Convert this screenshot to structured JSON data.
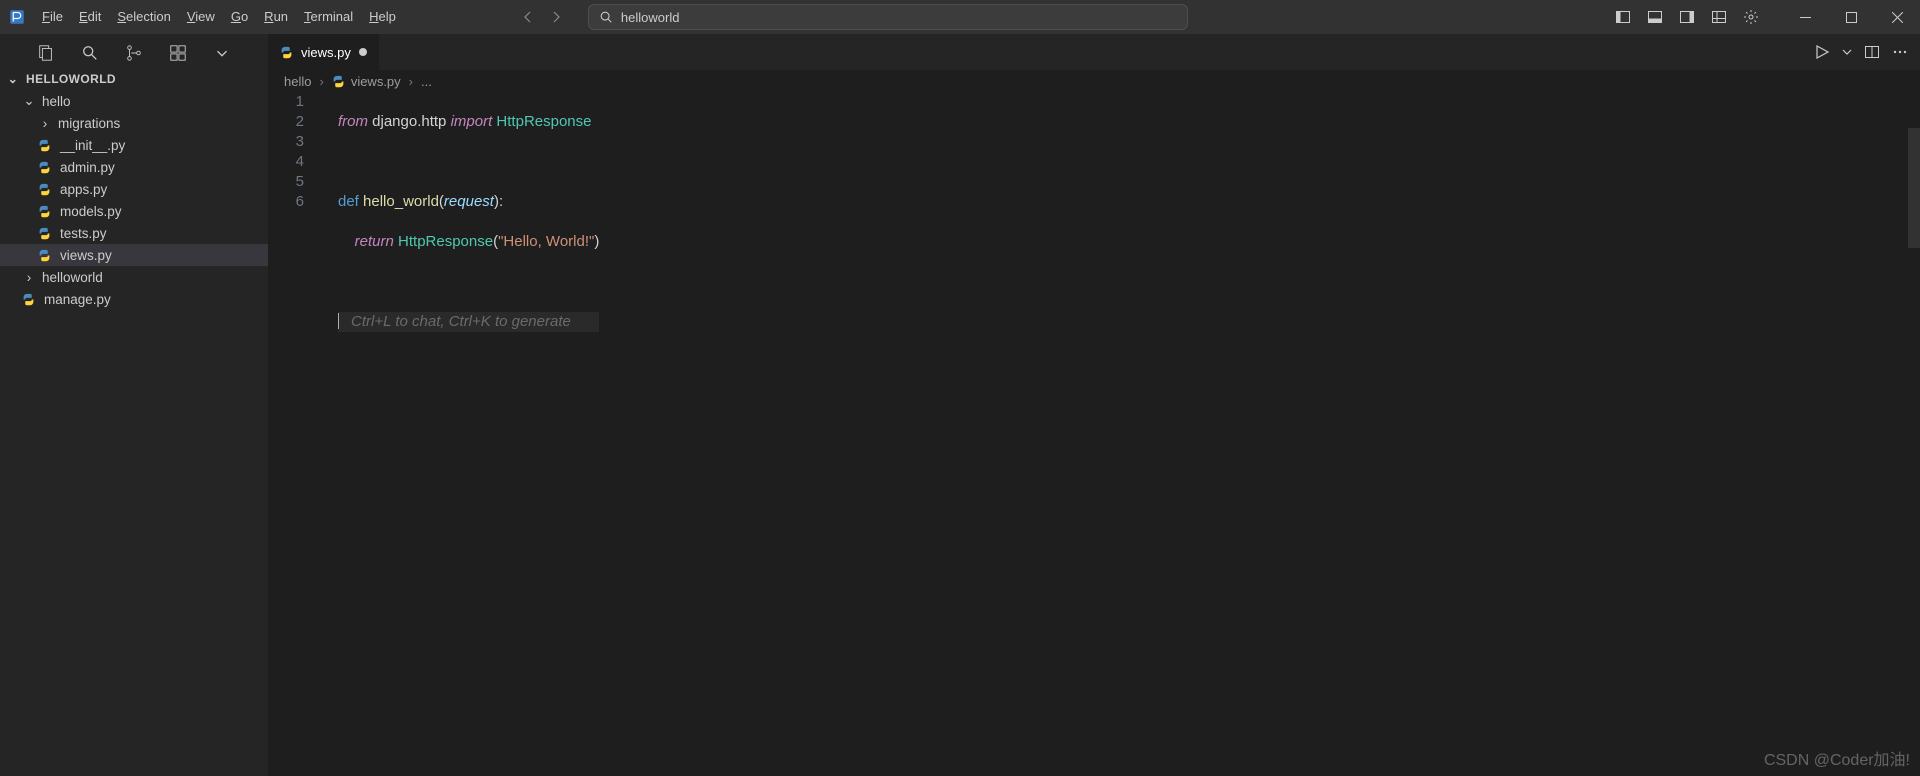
{
  "app": {
    "search_text": "helloworld",
    "project": "HELLOWORLD"
  },
  "menu": {
    "file": "File",
    "edit": "Edit",
    "selection": "Selection",
    "view": "View",
    "go": "Go",
    "run": "Run",
    "terminal": "Terminal",
    "help": "Help"
  },
  "tree": {
    "root_expanded": true,
    "items": [
      {
        "type": "folder",
        "name": "hello",
        "expanded": true,
        "depth": 1
      },
      {
        "type": "folder",
        "name": "migrations",
        "expanded": false,
        "depth": 2
      },
      {
        "type": "file",
        "name": "__init__.py",
        "depth": 2
      },
      {
        "type": "file",
        "name": "admin.py",
        "depth": 2
      },
      {
        "type": "file",
        "name": "apps.py",
        "depth": 2
      },
      {
        "type": "file",
        "name": "models.py",
        "depth": 2
      },
      {
        "type": "file",
        "name": "tests.py",
        "depth": 2
      },
      {
        "type": "file",
        "name": "views.py",
        "depth": 2,
        "selected": true
      },
      {
        "type": "folder",
        "name": "helloworld",
        "expanded": false,
        "depth": 1
      },
      {
        "type": "file",
        "name": "manage.py",
        "depth": 1
      }
    ]
  },
  "tab": {
    "label": "views.py",
    "dirty": true
  },
  "breadcrumb": {
    "parts": [
      "hello",
      "views.py",
      "..."
    ]
  },
  "code": {
    "line1": {
      "kw1": "from",
      "mod": " django.http ",
      "kw2": "import",
      "cls": " HttpResponse"
    },
    "line3": {
      "kw": "def ",
      "fn": "hello_world",
      "p1": "(",
      "param": "request",
      "p2": "):"
    },
    "line4": {
      "indent": "    ",
      "kw": "return",
      "sp": " ",
      "cls": "HttpResponse",
      "p1": "(",
      "str": "\"Hello, World!\"",
      "p2": ")"
    },
    "hint": "Ctrl+L to chat, Ctrl+K to generate"
  },
  "line_numbers": [
    "1",
    "2",
    "3",
    "4",
    "5",
    "6"
  ],
  "watermark": "CSDN @Coder加油!"
}
